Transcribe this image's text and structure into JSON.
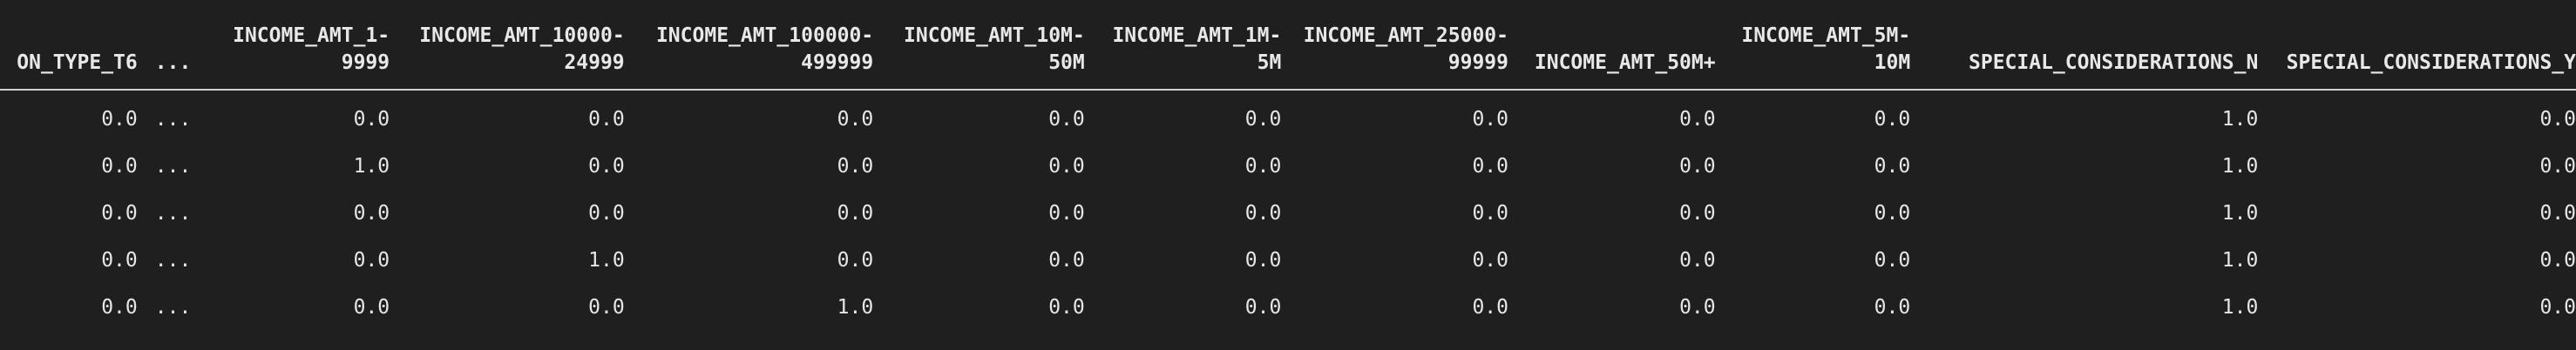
{
  "table": {
    "columns": [
      "ON_TYPE_T6",
      "...",
      "INCOME_AMT_1-\n9999",
      "INCOME_AMT_10000-\n24999",
      "INCOME_AMT_100000-\n499999",
      "INCOME_AMT_10M-\n50M",
      "INCOME_AMT_1M-\n5M",
      "INCOME_AMT_25000-\n99999",
      "INCOME_AMT_50M+",
      "INCOME_AMT_5M-\n10M",
      "SPECIAL_CONSIDERATIONS_N",
      "SPECIAL_CONSIDERATIONS_Y"
    ],
    "rows": [
      [
        "0.0",
        "...",
        "0.0",
        "0.0",
        "0.0",
        "0.0",
        "0.0",
        "0.0",
        "0.0",
        "0.0",
        "1.0",
        "0.0"
      ],
      [
        "0.0",
        "...",
        "1.0",
        "0.0",
        "0.0",
        "0.0",
        "0.0",
        "0.0",
        "0.0",
        "0.0",
        "1.0",
        "0.0"
      ],
      [
        "0.0",
        "...",
        "0.0",
        "0.0",
        "0.0",
        "0.0",
        "0.0",
        "0.0",
        "0.0",
        "0.0",
        "1.0",
        "0.0"
      ],
      [
        "0.0",
        "...",
        "0.0",
        "1.0",
        "0.0",
        "0.0",
        "0.0",
        "0.0",
        "0.0",
        "0.0",
        "1.0",
        "0.0"
      ],
      [
        "0.0",
        "...",
        "0.0",
        "0.0",
        "1.0",
        "0.0",
        "0.0",
        "0.0",
        "0.0",
        "0.0",
        "1.0",
        "0.0"
      ]
    ]
  },
  "colors": {
    "background": "#1f1f1f",
    "text": "#e6e6e6",
    "header_rule": "#d0d0d0"
  }
}
